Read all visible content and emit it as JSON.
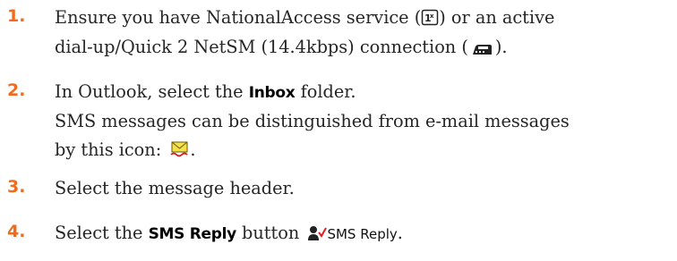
{
  "steps": [
    {
      "number": "1.",
      "line1_prefix": "Ensure you have NationalAccess service (",
      "line1_suffix": ") or an active",
      "line2_prefix": "dial-up/Quick 2 NetSM (14.4kbps) connection (",
      "line2_suffix": ")."
    },
    {
      "number": "2.",
      "prefix": "In Outlook, select the ",
      "ui_term": "Inbox",
      "suffix": " folder.",
      "note_line1": "SMS messages can be distinguished from e-mail messages",
      "note_line2_prefix": "by this icon: ",
      "note_line2_suffix": "."
    },
    {
      "number": "3.",
      "text": "Select the message header."
    },
    {
      "number": "4.",
      "prefix": "Select the ",
      "ui_term": "SMS Reply",
      "middle": " button ",
      "button_label": "SMS Reply",
      "suffix": "."
    }
  ],
  "icons": {
    "national_access": "1x-service-icon",
    "dialup": "dialup-connection-icon",
    "sms_message": "sms-envelope-icon",
    "sms_reply": "sms-reply-icon"
  },
  "colors": {
    "step_number": "#f26b1d",
    "text": "#262626"
  }
}
